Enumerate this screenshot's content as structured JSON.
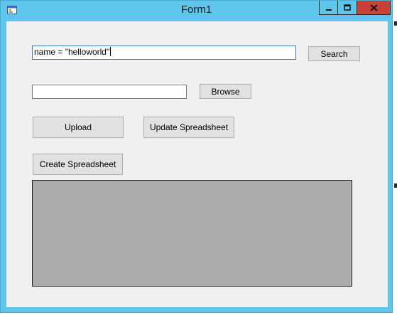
{
  "window": {
    "title": "Form1",
    "icons": {
      "app": "form-app-icon",
      "minimize": "minimize-icon",
      "maximize": "maximize-icon",
      "close": "close-icon"
    },
    "colors": {
      "frame": "#5ec6ea",
      "close_button": "#c7413a",
      "client_background": "#f0f0f0",
      "panel_background": "#ababab"
    }
  },
  "search": {
    "value": "name = \"helloworld\"",
    "button_label": "Search"
  },
  "file": {
    "value": "",
    "browse_label": "Browse"
  },
  "actions": {
    "upload_label": "Upload",
    "update_label": "Update Spreadsheet",
    "create_label": "Create Spreadsheet"
  }
}
